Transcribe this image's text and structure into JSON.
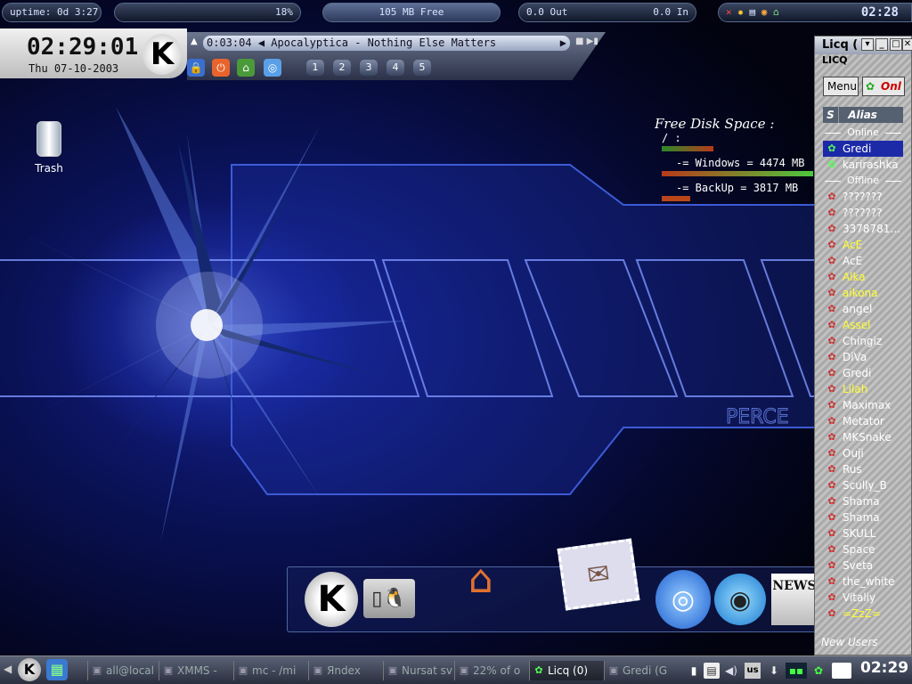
{
  "top_bar": {
    "uptime": "uptime: 0d 3:27",
    "cpu_percent": "18%",
    "memory_free": "105 MB Free",
    "net_out": "0.0 Out",
    "net_in": "0.0 In",
    "clock": "02:28"
  },
  "clock_panel": {
    "time": "02:29:01",
    "date": "Thu 07-10-2003"
  },
  "xmms": {
    "elapsed": "0:03:04",
    "track": "Apocalyptica - Nothing Else Matters",
    "workspaces": [
      "1",
      "2",
      "3",
      "4",
      "5"
    ]
  },
  "desktop": {
    "trash_label": "Trash",
    "wallpaper_text": "PERCE"
  },
  "disk_space": {
    "title": "Free Disk Space :",
    "root_label": "/ :",
    "windows_label": "-= Windows = 4474 MB",
    "backup_label": "-= BackUp  =  3817 MB",
    "colors": {
      "root": "#b83a1a",
      "windows": "#4cc83c",
      "backup": "#b8461a"
    }
  },
  "dock": {
    "news_label": "NEWS"
  },
  "licq": {
    "title": "Licq (",
    "menu_label": "LICQ",
    "menu_button": "Menu",
    "status_button": "Onl",
    "col_status": "S",
    "col_alias": "Alias",
    "group_online": "Online",
    "group_offline": "Offline",
    "online": [
      {
        "name": "Gredi",
        "color": "#ffffff",
        "selected": true
      },
      {
        "name": "karirashka",
        "color": "#ffffff",
        "selected": false
      }
    ],
    "offline": [
      {
        "name": "???????",
        "color": "#ffffff"
      },
      {
        "name": "???????",
        "color": "#ffffff"
      },
      {
        "name": "3378781...",
        "color": "#ffffff"
      },
      {
        "name": "AcE",
        "color": "#ffff33"
      },
      {
        "name": "AcE",
        "color": "#ffffff"
      },
      {
        "name": "Alka",
        "color": "#ffff33"
      },
      {
        "name": "aikona",
        "color": "#ffff33"
      },
      {
        "name": "angel",
        "color": "#ffffff"
      },
      {
        "name": "Assel",
        "color": "#ffff33"
      },
      {
        "name": "Chingiz",
        "color": "#ffffff"
      },
      {
        "name": "DiVa",
        "color": "#ffffff"
      },
      {
        "name": "Gredi",
        "color": "#ffffff"
      },
      {
        "name": "Lilah",
        "color": "#ffff33"
      },
      {
        "name": "Maximax",
        "color": "#ffffff"
      },
      {
        "name": "Metator",
        "color": "#ffffff"
      },
      {
        "name": "MKSnake",
        "color": "#ffffff"
      },
      {
        "name": "Ouji",
        "color": "#ffffff"
      },
      {
        "name": "Rus",
        "color": "#ffffff"
      },
      {
        "name": "Scully_B",
        "color": "#ffffff"
      },
      {
        "name": "Shama",
        "color": "#ffffff"
      },
      {
        "name": "Shama",
        "color": "#ffffff"
      },
      {
        "name": "SKULL",
        "color": "#ffffff"
      },
      {
        "name": "Space",
        "color": "#ffffff"
      },
      {
        "name": "Sveta",
        "color": "#ffffff"
      },
      {
        "name": "the_white",
        "color": "#ffffff"
      },
      {
        "name": "Vitaliy",
        "color": "#ffffff"
      },
      {
        "name": "=ZzZ=",
        "color": "#ffff33"
      }
    ],
    "new_users": "New Users"
  },
  "taskbar": {
    "tasks": [
      {
        "label": "all@local",
        "active": false
      },
      {
        "label": "XMMS -",
        "active": false
      },
      {
        "label": "mc - /mi",
        "active": false
      },
      {
        "label": "Яndex",
        "active": false
      },
      {
        "label": "Nursat sv",
        "active": false
      },
      {
        "label": "22% of o",
        "active": false
      },
      {
        "label": "Licq (0)",
        "active": true
      },
      {
        "label": "Gredi (G",
        "active": false
      }
    ],
    "clock": "02:29"
  }
}
